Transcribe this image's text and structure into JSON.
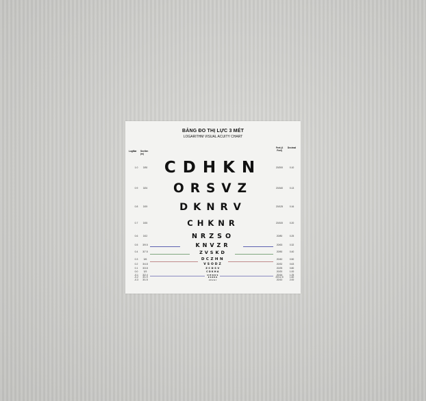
{
  "chart": {
    "title": "BẢNG ĐO THỊ LỰC 3 MÉT",
    "subtitle": "LOGARITHM VISUAL ACUITY CHART",
    "headers": {
      "logmar": "LogMar",
      "snellen": "Snellen (m)",
      "feet": "Feet (4 Feet)",
      "decimal": "Decimal"
    },
    "rows": [
      {
        "letters": "CDHKN",
        "logmar": "1.0",
        "snellen": "3/30",
        "feet": "20/200",
        "decimal": "0.10"
      },
      {
        "letters": "ORSVZ",
        "logmar": "0.9",
        "snellen": "3/24",
        "feet": "20/160",
        "decimal": "0.13"
      },
      {
        "letters": "DKNRV",
        "logmar": "0.8",
        "snellen": "3/19",
        "feet": "20/125",
        "decimal": "0.16"
      },
      {
        "letters": "CHKNR",
        "logmar": "0.7",
        "snellen": "3/15",
        "feet": "20/100",
        "decimal": "0.20"
      },
      {
        "letters": "NRZSO",
        "logmar": "0.6",
        "snellen": "3/12",
        "feet": "20/80",
        "decimal": "0.25"
      },
      {
        "letters": "KNVZR",
        "logmar": "0.5",
        "snellen": "3/9.5",
        "feet": "20/63",
        "decimal": "0.32"
      },
      {
        "letters": "ZVSKD",
        "logmar": "0.4",
        "snellen": "3/7.5",
        "feet": "20/50",
        "decimal": "0.40"
      },
      {
        "letters": "DCZHN",
        "logmar": "0.3",
        "snellen": "3/6",
        "feet": "20/40",
        "decimal": "0.50"
      },
      {
        "letters": "VSODZ",
        "logmar": "0.2",
        "snellen": "3/4.8",
        "feet": "20/32",
        "decimal": "0.63"
      },
      {
        "letters": "ZCDSV",
        "logmar": "0.1",
        "snellen": "3/3.8",
        "feet": "20/25",
        "decimal": "0.80"
      },
      {
        "letters": "CDKHA",
        "logmar": "0.0",
        "snellen": "3/3",
        "feet": "20/20",
        "decimal": "1.00"
      },
      {
        "letters": "OHNKS",
        "logmar": "-0.1",
        "snellen": "3/2.4",
        "feet": "20/16",
        "decimal": "1.25"
      },
      {
        "letters": "KSNRO",
        "logmar": "-0.2",
        "snellen": "3/1.9",
        "feet": "20/12.5",
        "decimal": "1.60"
      },
      {
        "letters": "ZDVHC",
        "logmar": "-0.3",
        "snellen": "3/1.5",
        "feet": "20/10",
        "decimal": "2.00"
      }
    ],
    "guide_colors": [
      "#5b5fb0",
      "#7fa67f",
      "#c08a8a",
      "#8a8ac0"
    ]
  }
}
